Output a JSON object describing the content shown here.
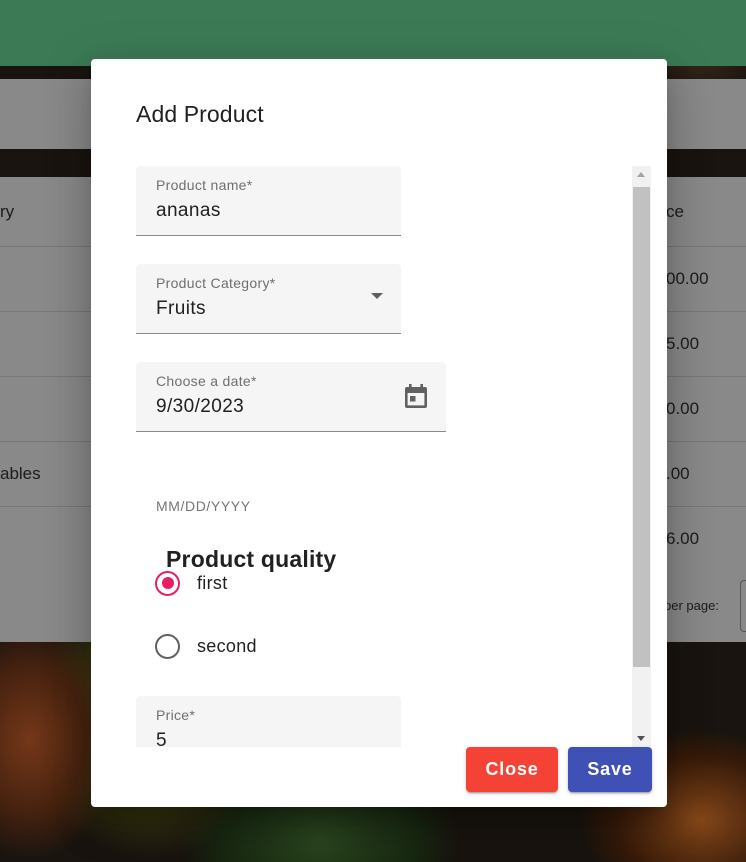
{
  "background": {
    "table": {
      "header_left": "ry",
      "header_right": "ce",
      "left_cells": [
        "ables"
      ],
      "right_cells": [
        "00.00",
        "5.00",
        "0.00",
        ".00",
        "6.00"
      ],
      "pager_label": "per page:"
    }
  },
  "dialog": {
    "title": "Add Product",
    "fields": {
      "product_name": {
        "label": "Product name*",
        "value": "ananas"
      },
      "category": {
        "label": "Product Category*",
        "value": "Fruits"
      },
      "date": {
        "label": "Choose a date*",
        "value": "9/30/2023",
        "hint": "MM/DD/YYYY"
      },
      "price": {
        "label": "Price*",
        "value": "5"
      }
    },
    "quality": {
      "title": "Product quality",
      "options": [
        {
          "label": "first",
          "selected": true
        },
        {
          "label": "second",
          "selected": false
        }
      ]
    },
    "actions": {
      "close_label": "Close",
      "save_label": "Save"
    }
  },
  "colors": {
    "topbar": "#3f7f5a",
    "radio_accent": "#e91e63",
    "close_button": "#f44336",
    "save_button": "#3f51b5"
  },
  "icons": {
    "dropdown": "arrow-drop-down-icon",
    "date": "calendar-icon"
  }
}
